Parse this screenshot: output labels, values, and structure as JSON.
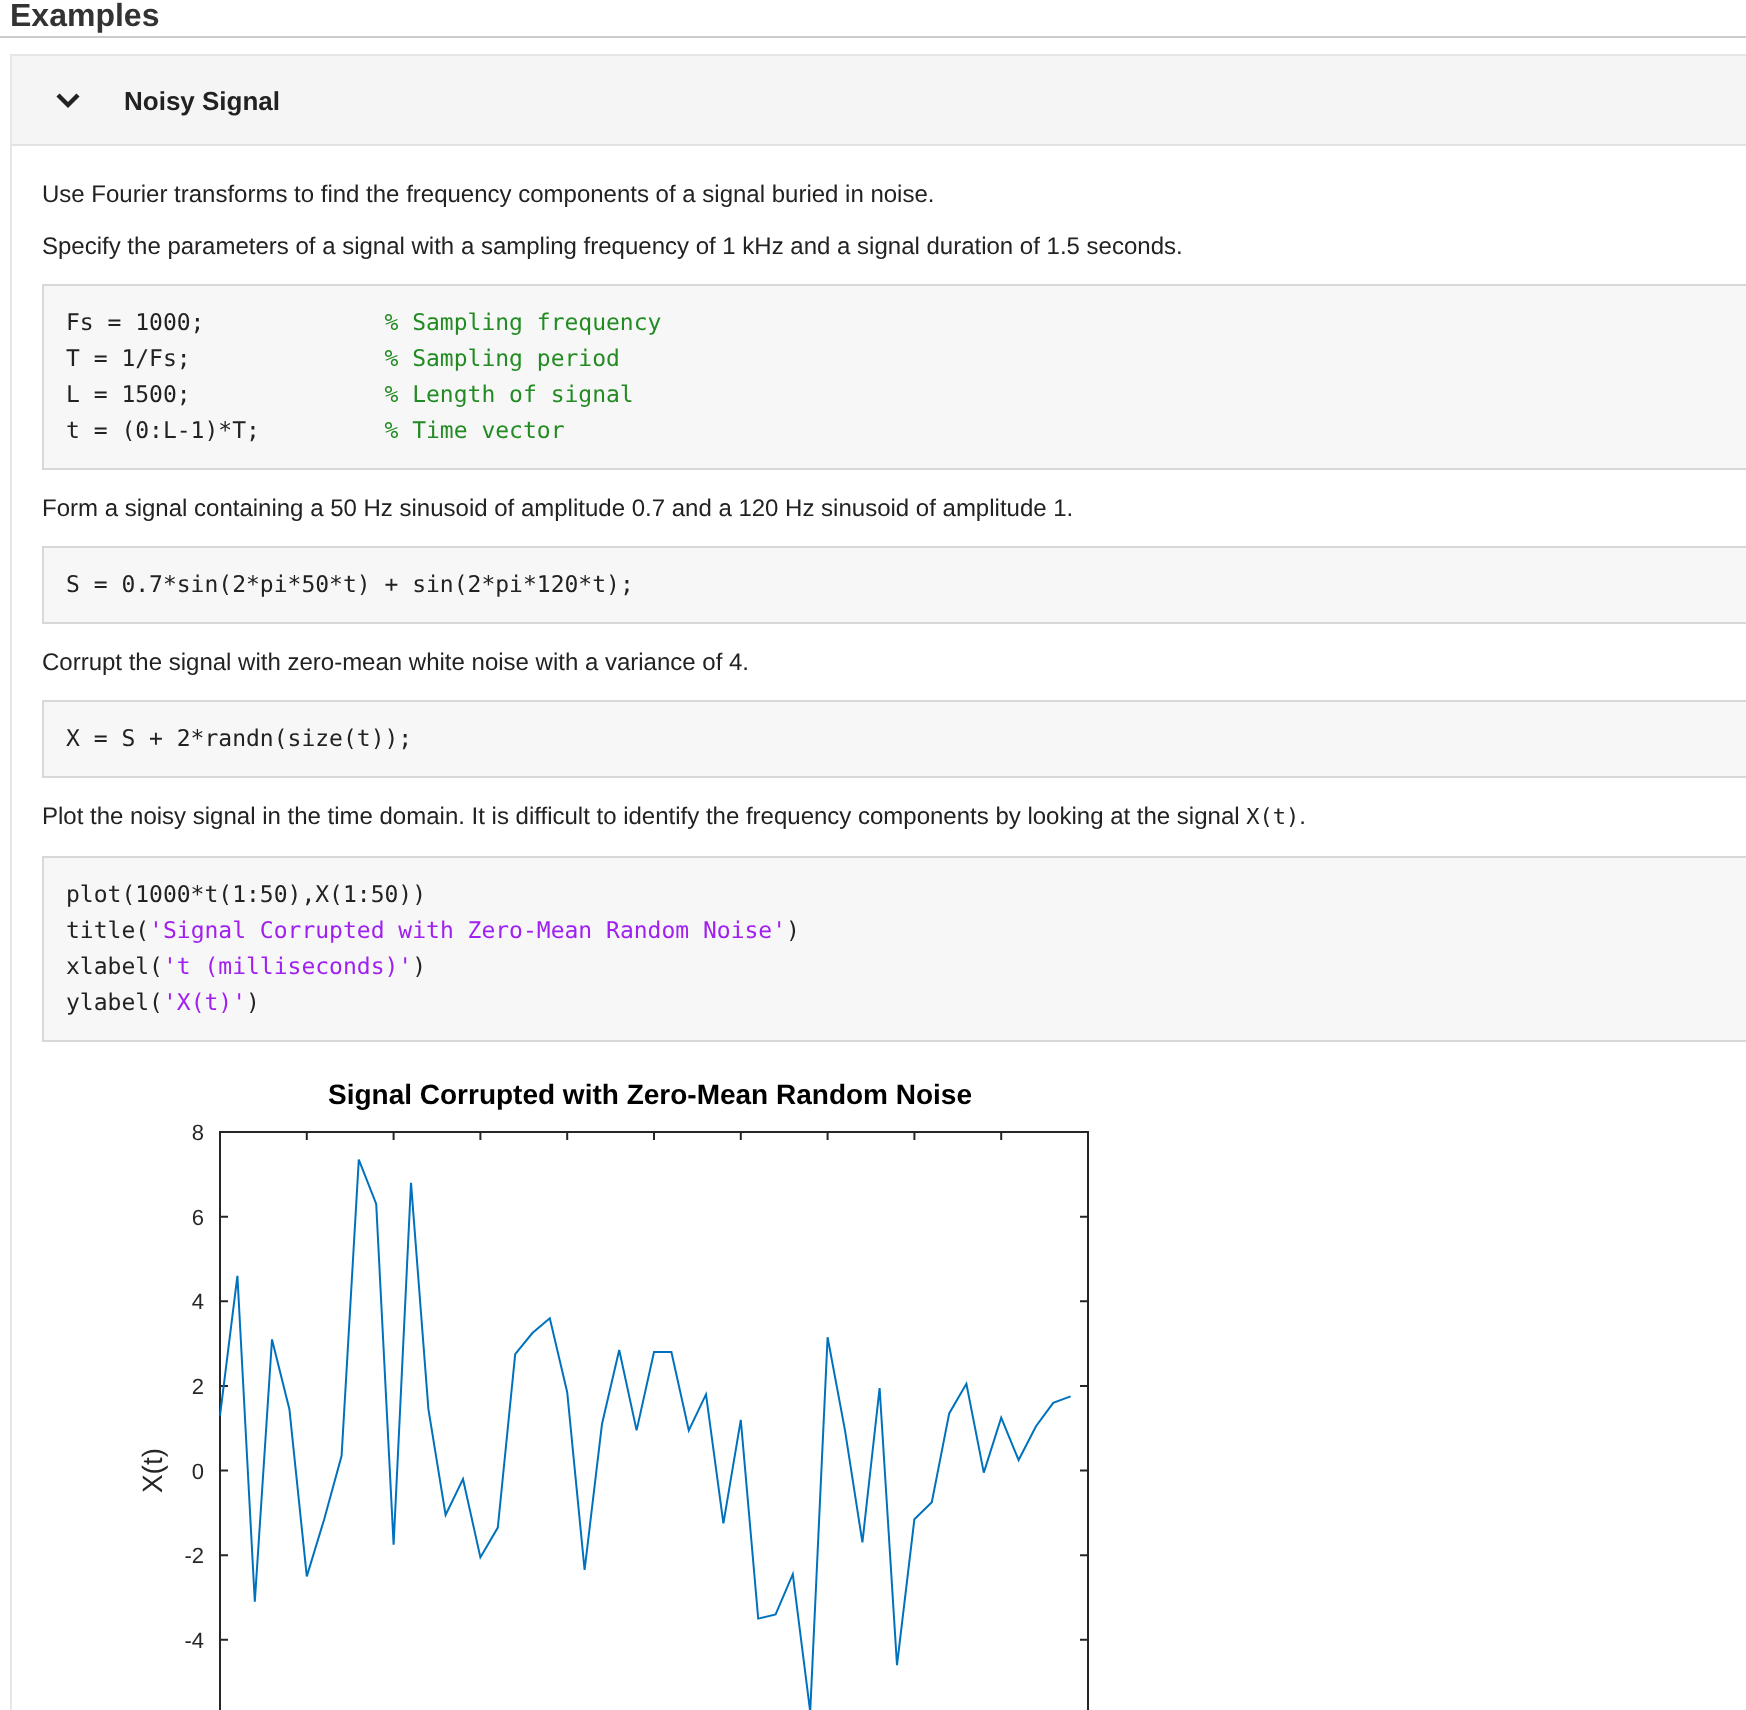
{
  "heading": "Examples",
  "section": {
    "title": "Noisy Signal",
    "expanded": true,
    "content": [
      {
        "kind": "paragraph",
        "segments": [
          {
            "kind": "text",
            "text": "Use Fourier transforms to find the frequency components of a signal buried in noise."
          }
        ]
      },
      {
        "kind": "paragraph",
        "segments": [
          {
            "kind": "text",
            "text": "Specify the parameters of a signal with a sampling frequency of 1 kHz and a signal duration of 1.5 seconds."
          }
        ]
      },
      {
        "kind": "code",
        "lines": [
          [
            {
              "kind": "code",
              "text": "Fs = 1000;"
            },
            {
              "kind": "comment",
              "text": "% Sampling frequency"
            }
          ],
          [
            {
              "kind": "code",
              "text": "T = 1/Fs;"
            },
            {
              "kind": "comment",
              "text": "% Sampling period"
            }
          ],
          [
            {
              "kind": "code",
              "text": "L = 1500;"
            },
            {
              "kind": "comment",
              "text": "% Length of signal"
            }
          ],
          [
            {
              "kind": "code",
              "text": "t = (0:L-1)*T;"
            },
            {
              "kind": "comment",
              "text": "% Time vector"
            }
          ]
        ]
      },
      {
        "kind": "paragraph",
        "segments": [
          {
            "kind": "text",
            "text": "Form a signal containing a 50 Hz sinusoid of amplitude 0.7 and a 120 Hz sinusoid of amplitude 1."
          }
        ]
      },
      {
        "kind": "code",
        "lines": [
          [
            {
              "kind": "code",
              "text": "S = 0.7*sin(2*pi*50*t) + sin(2*pi*120*t);"
            }
          ]
        ]
      },
      {
        "kind": "paragraph",
        "segments": [
          {
            "kind": "text",
            "text": "Corrupt the signal with zero-mean white noise with a variance of 4."
          }
        ]
      },
      {
        "kind": "code",
        "lines": [
          [
            {
              "kind": "code",
              "text": "X = S + 2*randn(size(t));"
            }
          ]
        ]
      },
      {
        "kind": "paragraph",
        "segments": [
          {
            "kind": "text",
            "text": "Plot the noisy signal in the time domain. It is difficult to identify the frequency components by looking at the signal "
          },
          {
            "kind": "code",
            "text": "X(t)"
          },
          {
            "kind": "text",
            "text": "."
          }
        ]
      },
      {
        "kind": "code",
        "lines": [
          [
            {
              "kind": "code",
              "text": "plot(1000*t(1:50),X(1:50))"
            }
          ],
          [
            {
              "kind": "code",
              "text": "title("
            },
            {
              "kind": "string",
              "text": "'Signal Corrupted with Zero-Mean Random Noise'"
            },
            {
              "kind": "code",
              "text": ")"
            }
          ],
          [
            {
              "kind": "code",
              "text": "xlabel("
            },
            {
              "kind": "string",
              "text": "'t (milliseconds)'"
            },
            {
              "kind": "code",
              "text": ")"
            }
          ],
          [
            {
              "kind": "code",
              "text": "ylabel("
            },
            {
              "kind": "string",
              "text": "'X(t)'"
            },
            {
              "kind": "code",
              "text": ")"
            }
          ]
        ]
      },
      {
        "kind": "figure",
        "chart_data": {
          "type": "line",
          "title": "Signal Corrupted with Zero-Mean Random Noise",
          "ylabel": "X(t)",
          "categories": [
            null,
            null,
            null,
            null,
            null,
            null,
            null,
            null,
            null,
            null,
            null,
            null,
            null,
            null,
            null,
            null,
            null,
            null,
            null,
            null,
            null,
            null,
            null,
            null,
            null,
            null,
            null,
            null,
            null,
            null,
            null,
            null,
            null,
            null,
            null,
            null,
            null,
            null,
            null,
            null,
            null,
            null,
            null,
            null,
            null,
            null,
            null,
            null,
            null,
            null
          ],
          "series": [
            {
              "color": "#0072bd",
              "values": [
                1.3,
                4.6,
                -3.1,
                3.1,
                1.45,
                -2.5,
                -1.15,
                0.35,
                7.35,
                6.3,
                -1.75,
                6.8,
                1.45,
                -1.05,
                -0.2,
                -2.05,
                -1.35,
                2.75,
                3.25,
                3.6,
                1.85,
                -2.35,
                1.1,
                2.85,
                0.95,
                2.8,
                2.8,
                0.95,
                1.8,
                -1.25,
                1.2,
                -3.5,
                -3.4,
                -2.45,
                -5.7,
                3.15,
                0.95,
                -1.7,
                1.95,
                -4.6,
                -1.15,
                -0.75,
                1.35,
                2.05,
                -0.05,
                1.25,
                0.25,
                1.05,
                1.6,
                1.75
              ]
            }
          ],
          "ylim": [
            -5.8,
            8
          ],
          "yticks": [
            {
              "value": -4,
              "label": "-4"
            },
            {
              "value": -2,
              "label": "-2"
            },
            {
              "value": 0,
              "label": "0"
            },
            {
              "value": 2,
              "label": "2"
            },
            {
              "value": 4,
              "label": "4"
            },
            {
              "value": 6,
              "label": "6"
            },
            {
              "value": 8,
              "label": "8"
            }
          ]
        }
      }
    ]
  }
}
